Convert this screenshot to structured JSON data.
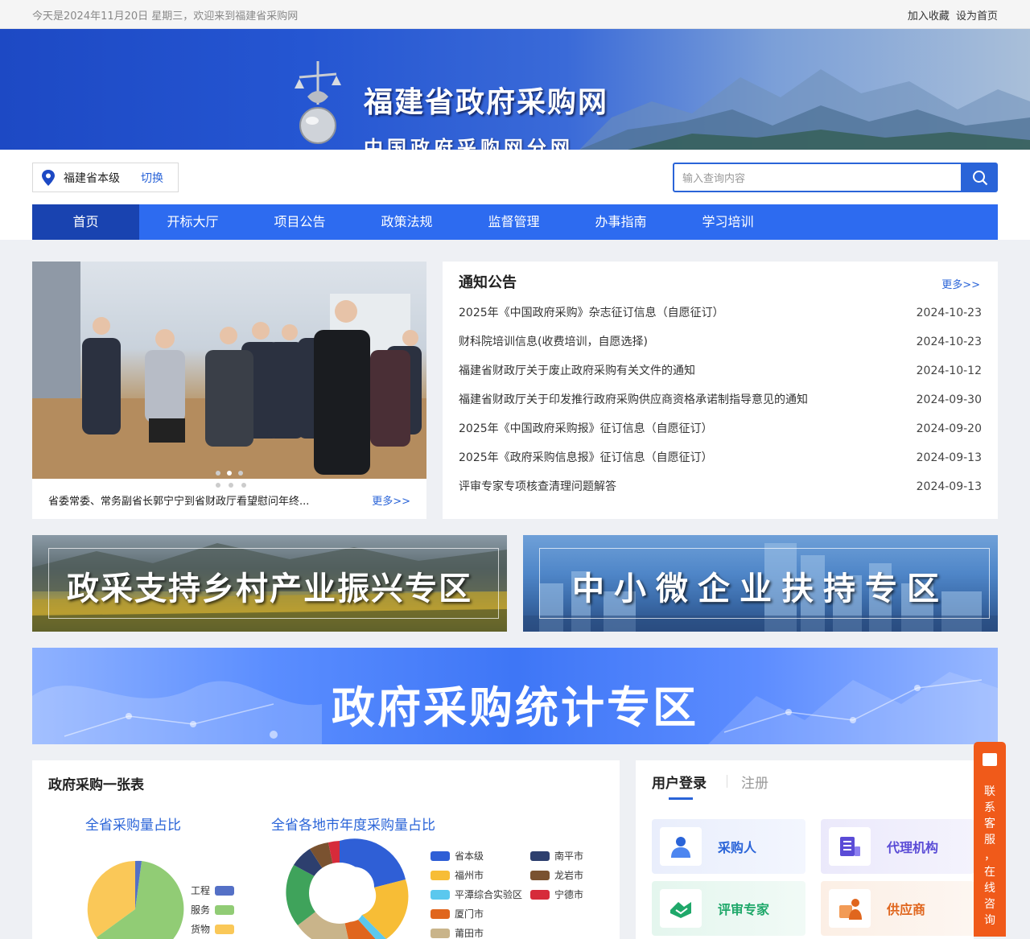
{
  "topbar": {
    "date_text": "今天是2024年11月20日 星期三，欢迎来到福建省采购网",
    "favorite": "加入收藏",
    "homepage": "设为首页"
  },
  "banner": {
    "title": "福建省政府采购网",
    "subtitle": "中国政府采购网分网"
  },
  "region": {
    "name": "福建省本级",
    "switch": "切换"
  },
  "search": {
    "placeholder": "输入查询内容"
  },
  "nav": [
    "首页",
    "开标大厅",
    "项目公告",
    "政策法规",
    "监督管理",
    "办事指南",
    "学习培训"
  ],
  "slider": {
    "caption": "省委常委、常务副省长郭宁宁到省财政厅看望慰问年终...",
    "more": "更多>>"
  },
  "notice": {
    "title": "通知公告",
    "more": "更多>>",
    "items": [
      {
        "title": "2025年《中国政府采购》杂志征订信息（自愿征订）",
        "date": "2024-10-23"
      },
      {
        "title": "财科院培训信息(收费培训，自愿选择)",
        "date": "2024-10-23"
      },
      {
        "title": "福建省财政厅关于废止政府采购有关文件的通知",
        "date": "2024-10-12"
      },
      {
        "title": "福建省财政厅关于印发推行政府采购供应商资格承诺制指导意见的通知",
        "date": "2024-09-30"
      },
      {
        "title": "2025年《中国政府采购报》征订信息（自愿征订）",
        "date": "2024-09-20"
      },
      {
        "title": "2025年《政府采购信息报》征订信息（自愿征订）",
        "date": "2024-09-13"
      },
      {
        "title": "评审专家专项核查清理问题解答",
        "date": "2024-09-13"
      }
    ]
  },
  "promo": {
    "rural": "政采支持乡村产业振兴专区",
    "sme": "中小微企业扶持专区",
    "stats": "政府采购统计专区"
  },
  "table_panel": {
    "title": "政府采购一张表"
  },
  "chart_data": [
    {
      "type": "pie",
      "title": "全省采购量占比",
      "legend": [
        {
          "name": "工程",
          "color": "#5470c6"
        },
        {
          "name": "服务",
          "color": "#91cc75"
        },
        {
          "name": "货物",
          "color": "#fac858"
        }
      ]
    },
    {
      "type": "pie",
      "title": "全省各地市年度采购量占比",
      "legend": [
        {
          "name": "省本级",
          "color": "#2f5fd6"
        },
        {
          "name": "南平市",
          "color": "#2d3f6e"
        },
        {
          "name": "福州市",
          "color": "#f7bd36"
        },
        {
          "name": "龙岩市",
          "color": "#7a5230"
        },
        {
          "name": "平潭综合实验区",
          "color": "#5bc8ee"
        },
        {
          "name": "宁德市",
          "color": "#d62b3a"
        },
        {
          "name": "厦门市",
          "color": "#e0661e"
        },
        {
          "name": "莆田市",
          "color": "#c9b48a"
        }
      ]
    }
  ],
  "login": {
    "tab_login": "用户登录",
    "tab_register": "注册",
    "roles": [
      {
        "label": "采购人",
        "icon": "buyer-icon",
        "color": "#2a64d8"
      },
      {
        "label": "代理机构",
        "icon": "agency-icon",
        "color": "#5a4bd6"
      },
      {
        "label": "评审专家",
        "icon": "expert-icon",
        "color": "#1fa86a"
      },
      {
        "label": "供应商",
        "icon": "supplier-icon",
        "color": "#e0661e"
      }
    ]
  },
  "service": {
    "text": "联系客服，在线咨询"
  }
}
